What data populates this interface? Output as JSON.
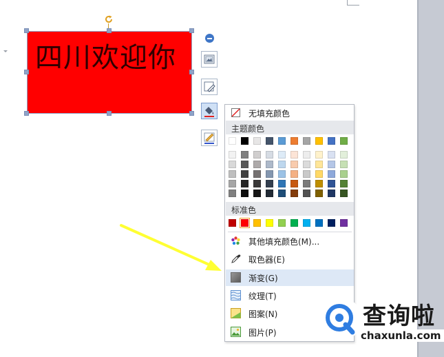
{
  "document": {
    "shape_text": "四川欢迎你",
    "shape_fill": "#ff0000"
  },
  "mini_toolbar": {
    "buttons": [
      "minus-circle-icon",
      "picture-layout-icon",
      "edit-shape-icon",
      "fill-bucket-icon",
      "outline-pen-icon"
    ],
    "accent": "#3f76c7"
  },
  "fill_menu": {
    "no_fill_label": "无填充颜色",
    "theme_colors_title": "主题颜色",
    "theme_colors": [
      [
        "#ffffff",
        "#000000",
        "#e7e6e6",
        "#44546a",
        "#5b9bd5",
        "#ed7d31",
        "#a5a5a5",
        "#ffc000",
        "#4472c4",
        "#70ad47"
      ],
      [
        "#f2f2f2",
        "#7f7f7f",
        "#d0cece",
        "#d6dce4",
        "#ddebf7",
        "#fce4d6",
        "#ededed",
        "#fff2cc",
        "#d9e1f2",
        "#e2efda"
      ],
      [
        "#d9d9d9",
        "#595959",
        "#aeaaaa",
        "#adb9ca",
        "#bdd7ee",
        "#f8cbad",
        "#dbdbdb",
        "#ffe699",
        "#b4c6e7",
        "#c6e0b4"
      ],
      [
        "#bfbfbf",
        "#404040",
        "#757171",
        "#8497b0",
        "#9bc2e6",
        "#f4b084",
        "#c9c9c9",
        "#ffd966",
        "#8ea9db",
        "#a9d08e"
      ],
      [
        "#a6a6a6",
        "#262626",
        "#3a3838",
        "#333f4f",
        "#2f75b5",
        "#c65911",
        "#7b7b7b",
        "#bf8f00",
        "#305496",
        "#548235"
      ],
      [
        "#808080",
        "#0d0d0d",
        "#161616",
        "#222b35",
        "#1f4e78",
        "#833c0b",
        "#525252",
        "#7f6000",
        "#203764",
        "#375623"
      ]
    ],
    "standard_colors_title": "标准色",
    "standard_colors": [
      "#c00000",
      "#ff0000",
      "#ffc000",
      "#ffff00",
      "#92d050",
      "#00b050",
      "#00b0f0",
      "#0070c0",
      "#002060",
      "#7030a0"
    ],
    "more_colors_label": "其他填充颜色(M)...",
    "eyedropper_label": "取色器(E)",
    "gradient_label": "渐变(G)",
    "texture_label": "纹理(T)",
    "pattern_label": "图案(N)",
    "picture_label": "图片(P)"
  },
  "annotation": {
    "arrow_color": "#ffff33"
  },
  "watermark": {
    "brand": "查询啦",
    "url": "chaxunla.com",
    "accent": "#2f7de1"
  }
}
